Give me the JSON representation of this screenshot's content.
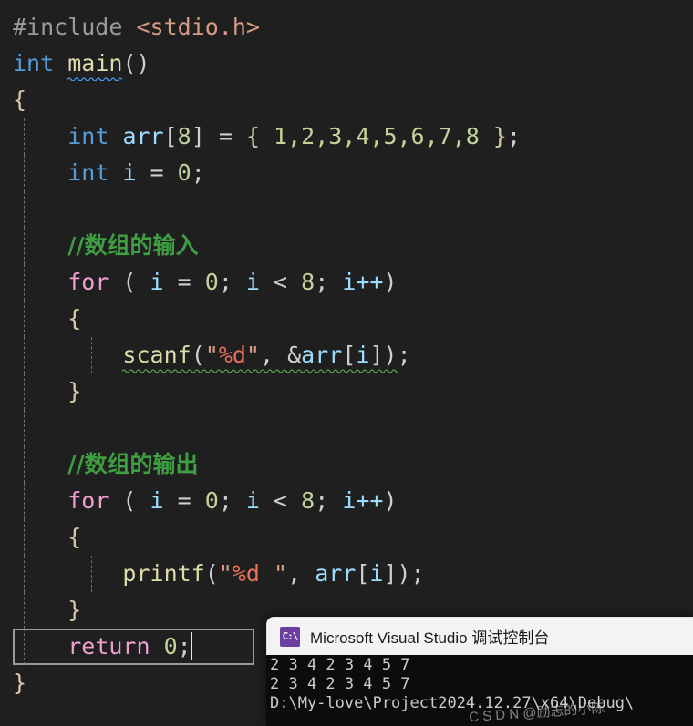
{
  "editor": {
    "theme_background": "#1f1f1f",
    "lines": [
      {
        "id": "line-include",
        "kind": "code"
      },
      {
        "id": "line-main",
        "kind": "code"
      },
      {
        "id": "line-open-brace",
        "kind": "code"
      },
      {
        "id": "line-arr-decl",
        "kind": "code"
      },
      {
        "id": "line-i-decl",
        "kind": "code"
      },
      {
        "id": "line-blank-1",
        "kind": "blank"
      },
      {
        "id": "line-comment-in",
        "kind": "code"
      },
      {
        "id": "line-for-in",
        "kind": "code"
      },
      {
        "id": "line-brace-in-open",
        "kind": "code"
      },
      {
        "id": "line-scanf",
        "kind": "code"
      },
      {
        "id": "line-brace-in-close",
        "kind": "code"
      },
      {
        "id": "line-blank-2",
        "kind": "blank"
      },
      {
        "id": "line-comment-out",
        "kind": "code"
      },
      {
        "id": "line-for-out",
        "kind": "code"
      },
      {
        "id": "line-brace-out-open",
        "kind": "code"
      },
      {
        "id": "line-printf",
        "kind": "code"
      },
      {
        "id": "line-brace-out-close",
        "kind": "code"
      },
      {
        "id": "line-return",
        "kind": "code"
      },
      {
        "id": "line-close-brace",
        "kind": "code"
      }
    ],
    "tokens": {
      "include_directive": "#include",
      "include_space": " ",
      "include_header": "<stdio.h>",
      "kw_int": "int",
      "fn_main": "main",
      "parens_empty": "()",
      "brace_open": "{",
      "brace_close": "}",
      "indent1": "    ",
      "indent2": "        ",
      "var_arr": "arr",
      "arr_index_open": "[",
      "arr_size": "8",
      "arr_index_close": "]",
      "assign": " = ",
      "init_open": "{ ",
      "init_values": "1,2,3,4,5,6,7,8",
      "init_close": " }",
      "semicolon": ";",
      "var_i": "i",
      "zero": "0",
      "comment_input": "//数组的输入",
      "comment_output": "//数组的输出",
      "kw_for": "for",
      "for_head_open": " ( ",
      "for_init": " = ",
      "for_cond_sep": "; ",
      "for_lt": " < ",
      "for_limit": "8",
      "for_inc": "i++",
      "for_head_close": ")",
      "fn_scanf": "scanf",
      "fn_printf": "printf",
      "paren_open": "(",
      "paren_close": ")",
      "quote": "\"",
      "fmt_d": "%d",
      "fmt_d_space": "%d ",
      "comma_space": ", ",
      "ampersand": "&",
      "kw_return": "return",
      "return_space": " ",
      "return_value": "0"
    },
    "colors": {
      "preprocessor": "#9b9b9b",
      "header": "#d69d85",
      "keyword": "#569cd6",
      "function": "#dcdcaa",
      "variable": "#9cdcfe",
      "number": "#c3d49a",
      "control_keyword": "#ef9ed0",
      "comment": "#3f9e42",
      "string": "#d69d85",
      "format_specifier": "#e8705a",
      "punctuation": "#cfcfcf",
      "brace": "#d6c9a8",
      "squiggle_blue": "#4a9eff",
      "squiggle_green": "#59a14f",
      "current_line_border": "#9a9a9a",
      "caret": "#e6e6e6"
    }
  },
  "console": {
    "title": "Microsoft Visual Studio 调试控制台",
    "icon_label": "C:\\",
    "output_lines": [
      "2 3 4 2 3 4 5 7",
      "2 3 4 2 3 4 5 7",
      "D:\\My-love\\Project2024.12.27\\x64\\Debug\\"
    ],
    "watermark": "C S D N @励志的小陈",
    "background": "#0c0c0c",
    "titlebar_background": "#f3f3f6",
    "text_color": "#cccccc"
  }
}
